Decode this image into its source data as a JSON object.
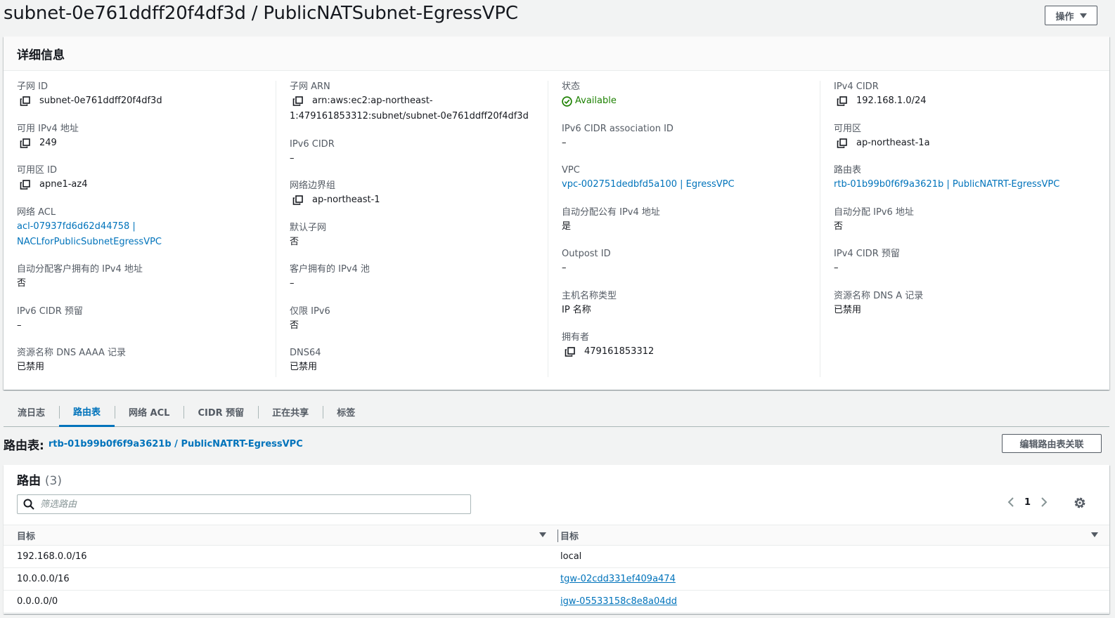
{
  "header": {
    "title": "subnet-0e761ddff20f4df3d / PublicNATSubnet-EgressVPC",
    "actions_label": "操作"
  },
  "details": {
    "title": "详细信息",
    "col1": [
      {
        "label": "子网 ID",
        "value": "subnet-0e761ddff20f4df3d",
        "copy": true
      },
      {
        "label": "可用 IPv4 地址",
        "value": "249",
        "copy": true
      },
      {
        "label": "可用区 ID",
        "value": "apne1-az4",
        "copy": true
      },
      {
        "label": "网络 ACL",
        "value": "acl-07937fd6d62d44758 |",
        "value2": "NACLforPublicSubnetEgressVPC",
        "link": true
      },
      {
        "label": "自动分配客户拥有的 IPv4 地址",
        "value": "否"
      },
      {
        "label": "IPv6 CIDR 预留",
        "value": "–"
      },
      {
        "label": "资源名称 DNS AAAA 记录",
        "value": "已禁用"
      }
    ],
    "col2": [
      {
        "label": "子网 ARN",
        "value": "arn:aws:ec2:ap-northeast-",
        "value2": "1:479161853312:subnet/subnet-0e761ddff20f4df3d",
        "copy": true
      },
      {
        "label": "IPv6 CIDR",
        "value": "–"
      },
      {
        "label": "网络边界组",
        "value": "ap-northeast-1",
        "copy": true
      },
      {
        "label": "默认子网",
        "value": "否"
      },
      {
        "label": "客户拥有的 IPv4 池",
        "value": "–"
      },
      {
        "label": "仅限 IPv6",
        "value": "否"
      },
      {
        "label": "DNS64",
        "value": "已禁用"
      }
    ],
    "col3": [
      {
        "label": "状态",
        "value": "Available",
        "status": "ok"
      },
      {
        "label": "IPv6 CIDR association ID",
        "value": "–"
      },
      {
        "label": "VPC",
        "value": "vpc-002751dedbfd5a100 | EgressVPC",
        "link": true
      },
      {
        "label": "自动分配公有 IPv4 地址",
        "value": "是"
      },
      {
        "label": "Outpost ID",
        "value": "–"
      },
      {
        "label": "主机名称类型",
        "value": "IP 名称"
      },
      {
        "label": "拥有者",
        "value": "479161853312",
        "copy": true
      }
    ],
    "col4": [
      {
        "label": "IPv4 CIDR",
        "value": "192.168.1.0/24",
        "copy": true
      },
      {
        "label": "可用区",
        "value": "ap-northeast-1a",
        "copy": true
      },
      {
        "label": "路由表",
        "value": "rtb-01b99b0f6f9a3621b | PublicNATRT-EgressVPC",
        "link": true
      },
      {
        "label": "自动分配 IPv6 地址",
        "value": "否"
      },
      {
        "label": "IPv4 CIDR 预留",
        "value": "–"
      },
      {
        "label": "资源名称 DNS A 记录",
        "value": "已禁用"
      }
    ]
  },
  "tabs": [
    "流日志",
    "路由表",
    "网络 ACL",
    "CIDR 预留",
    "正在共享",
    "标签"
  ],
  "active_tab": 1,
  "route_table": {
    "label": "路由表:",
    "link": "rtb-01b99b0f6f9a3621b / PublicNATRT-EgressVPC",
    "edit_button": "编辑路由表关联"
  },
  "routes": {
    "title": "路由",
    "count": "(3)",
    "search_placeholder": "筛选路由",
    "page": "1",
    "columns": [
      "目标",
      "目标"
    ],
    "rows": [
      {
        "destination": "192.168.0.0/16",
        "target": "local",
        "target_link": false
      },
      {
        "destination": "10.0.0.0/16",
        "target": "tgw-02cdd331ef409a474",
        "target_link": true
      },
      {
        "destination": "0.0.0.0/0",
        "target": "igw-05533158c8e8a04dd",
        "target_link": true
      }
    ]
  },
  "colors": {
    "link": "#0073bb",
    "success": "#1d8102",
    "text": "#16191f",
    "label": "#545b64"
  }
}
